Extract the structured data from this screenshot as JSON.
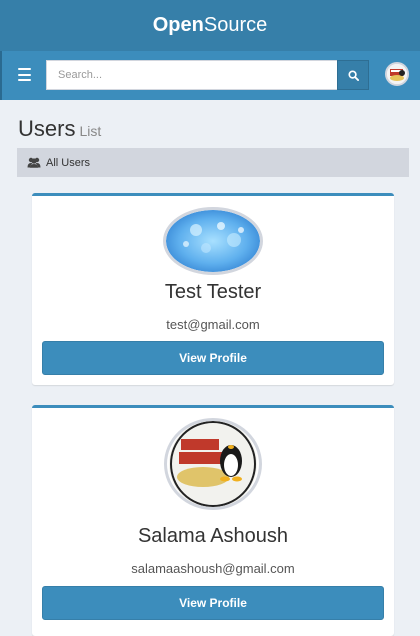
{
  "brand": {
    "bold": "Open",
    "regular": "Source"
  },
  "navbar": {
    "menu_icon": "hamburger-icon",
    "search": {
      "placeholder": "Search...",
      "value": "",
      "button_icon": "search-icon"
    },
    "avatar_icon": "user-avatar-icon"
  },
  "page": {
    "title": "Users",
    "subtitle": "List"
  },
  "breadcrumb": {
    "icon": "users-icon",
    "label": "All Users"
  },
  "users": [
    {
      "name": "Test Tester",
      "email": "test@gmail.com",
      "button_label": "View Profile",
      "avatar": "bokeh-avatar-image"
    },
    {
      "name": "Salama Ashoush",
      "email": "salamaashoush@gmail.com",
      "button_label": "View Profile",
      "avatar": "opensource-rocks-avatar-image"
    }
  ],
  "colors": {
    "header": "#367fa9",
    "navbar": "#3c8dbc",
    "button": "#3c8dbc",
    "background": "#ecf0f5"
  }
}
